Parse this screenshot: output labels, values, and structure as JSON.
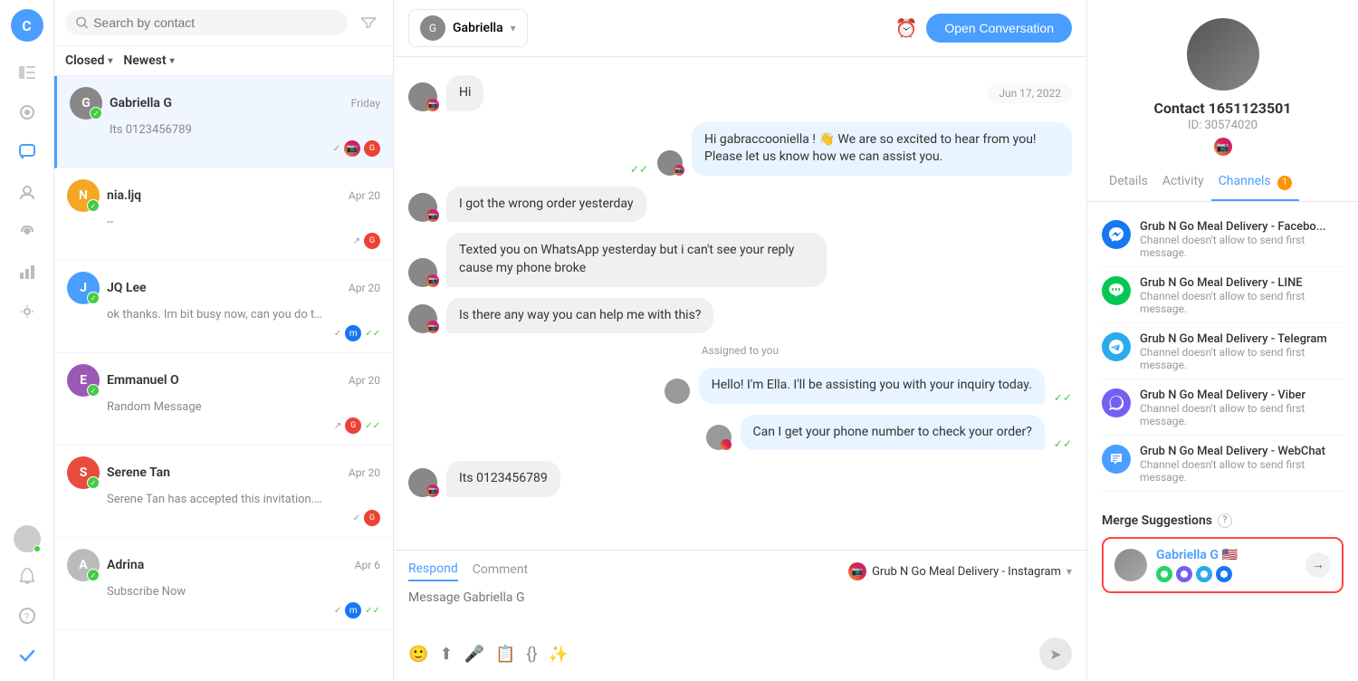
{
  "nav": {
    "avatar_letter": "C",
    "icons": [
      "☰",
      "◎",
      "💬",
      "👤",
      "📡",
      "📊",
      "⚙️",
      "🔔",
      "❓",
      "✓"
    ]
  },
  "conversations": {
    "search_placeholder": "Search by contact",
    "filter_label": "Closed",
    "sort_label": "Newest",
    "items": [
      {
        "id": "gabriella-g",
        "name": "Gabriella G",
        "time": "Friday",
        "preview": "Its 0123456789",
        "avatar_letter": "G",
        "avatar_color": "#888",
        "channels": [
          "instagram",
          "gmail"
        ],
        "active": true
      },
      {
        "id": "nia-ljq",
        "name": "nia.ljq",
        "time": "Apr 20",
        "preview": "--",
        "avatar_letter": "N",
        "avatar_color": "#f5a623",
        "channels": [
          "gmail"
        ],
        "active": false
      },
      {
        "id": "jq-lee",
        "name": "JQ Lee",
        "time": "Apr 20",
        "preview": "ok thanks. Im bit busy now, can you do the simple sign up for me...",
        "avatar_letter": "J",
        "avatar_color": "#4a9eff",
        "channels": [
          "messenger",
          "check"
        ],
        "active": false
      },
      {
        "id": "emmanuel-o",
        "name": "Emmanuel O",
        "time": "Apr 20",
        "preview": "Random Message",
        "avatar_letter": "E",
        "avatar_color": "#9b59b6",
        "channels": [
          "gmail",
          "check"
        ],
        "active": false
      },
      {
        "id": "serene-tan",
        "name": "Serene Tan",
        "time": "Apr 20",
        "preview": "Serene Tan has accepted this invitation. HOW TO GET WHATSAPP...",
        "avatar_letter": "S",
        "avatar_color": "#e74c3c",
        "channels": [
          "gmail"
        ],
        "active": false
      },
      {
        "id": "adrina",
        "name": "Adrina",
        "time": "Apr 6",
        "preview": "Subscribe Now",
        "avatar_letter": "A",
        "avatar_color": "#bbb",
        "channels": [
          "messenger",
          "check"
        ],
        "active": false
      }
    ]
  },
  "chat": {
    "contact_name": "Gabriella",
    "open_btn_label": "Open Conversation",
    "date_label": "Jun 17, 2022",
    "messages": [
      {
        "id": "msg1",
        "type": "incoming",
        "text": "Hi",
        "has_avatar": true
      },
      {
        "id": "msg2",
        "type": "outgoing",
        "text": "Hi gabraccooniella ! 👋 We are so excited to hear from you! Please let us know how we can assist you.",
        "has_avatar": false
      },
      {
        "id": "msg3",
        "type": "incoming",
        "text": "I got the wrong order yesterday",
        "has_avatar": true
      },
      {
        "id": "msg4",
        "type": "incoming",
        "text": "Texted you on WhatsApp yesterday but i can't see your reply cause my phone broke",
        "has_avatar": true
      },
      {
        "id": "msg5",
        "type": "incoming",
        "text": "Is there any way you can help me with this?",
        "has_avatar": true
      },
      {
        "id": "msg6",
        "type": "assigned",
        "text": "Assigned to you"
      },
      {
        "id": "msg7",
        "type": "outgoing",
        "text": "Hello! I'm Ella. I'll be assisting you with your inquiry today.",
        "has_avatar": false
      },
      {
        "id": "msg8",
        "type": "outgoing",
        "text": "Can I get your phone number to check your order?",
        "has_avatar": false
      },
      {
        "id": "msg9",
        "type": "incoming",
        "text": "Its 0123456789",
        "has_avatar": true
      }
    ],
    "reply": {
      "respond_tab": "Respond",
      "comment_tab": "Comment",
      "placeholder": "Message Gabriella G",
      "channel_label": "Grub N Go Meal Delivery - Instagram"
    }
  },
  "right_panel": {
    "contact_name": "Contact 1651123501",
    "contact_id": "ID: 30574020",
    "tabs": [
      "Details",
      "Activity",
      "Channels"
    ],
    "active_tab": "Channels",
    "tab_badge": "1",
    "channels": [
      {
        "name": "Grub N Go Meal Delivery - Facebo...",
        "note": "Channel doesn't allow to send first message.",
        "type": "messenger"
      },
      {
        "name": "Grub N Go Meal Delivery - LINE",
        "note": "Channel doesn't allow to send first message.",
        "type": "line"
      },
      {
        "name": "Grub N Go Meal Delivery - Telegram",
        "note": "Channel doesn't allow to send first message.",
        "type": "telegram"
      },
      {
        "name": "Grub N Go Meal Delivery - Viber",
        "note": "Channel doesn't allow to send first message.",
        "type": "viber"
      },
      {
        "name": "Grub N Go Meal Delivery - WebChat",
        "note": "Channel doesn't allow to send first message.",
        "type": "webchat"
      }
    ],
    "merge_title": "Merge Suggestions",
    "merge_contact": {
      "name": "Gabriella G 🇺🇸",
      "channels": [
        "whatsapp",
        "viber",
        "telegram",
        "messenger"
      ]
    }
  }
}
